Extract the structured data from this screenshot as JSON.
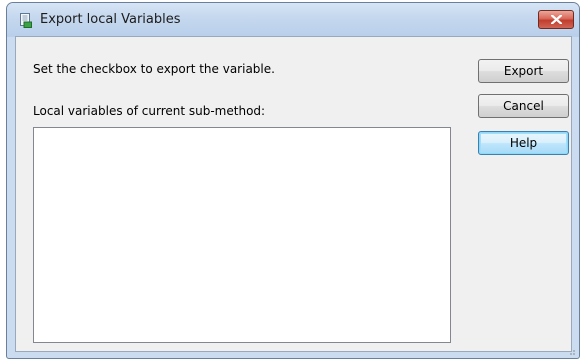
{
  "window": {
    "title": "Export local Variables",
    "icon": "export-document-icon",
    "close_icon": "close-icon"
  },
  "dialog": {
    "instruction": "Set the checkbox to export the variable.",
    "list_label": "Local variables of current sub-method:",
    "variables": []
  },
  "buttons": {
    "export_label": "Export",
    "cancel_label": "Cancel",
    "help_label": "Help"
  },
  "colors": {
    "close_button": "#c13d2d",
    "default_button_border": "#3c7fb1",
    "frame": "#bcd1ea"
  }
}
